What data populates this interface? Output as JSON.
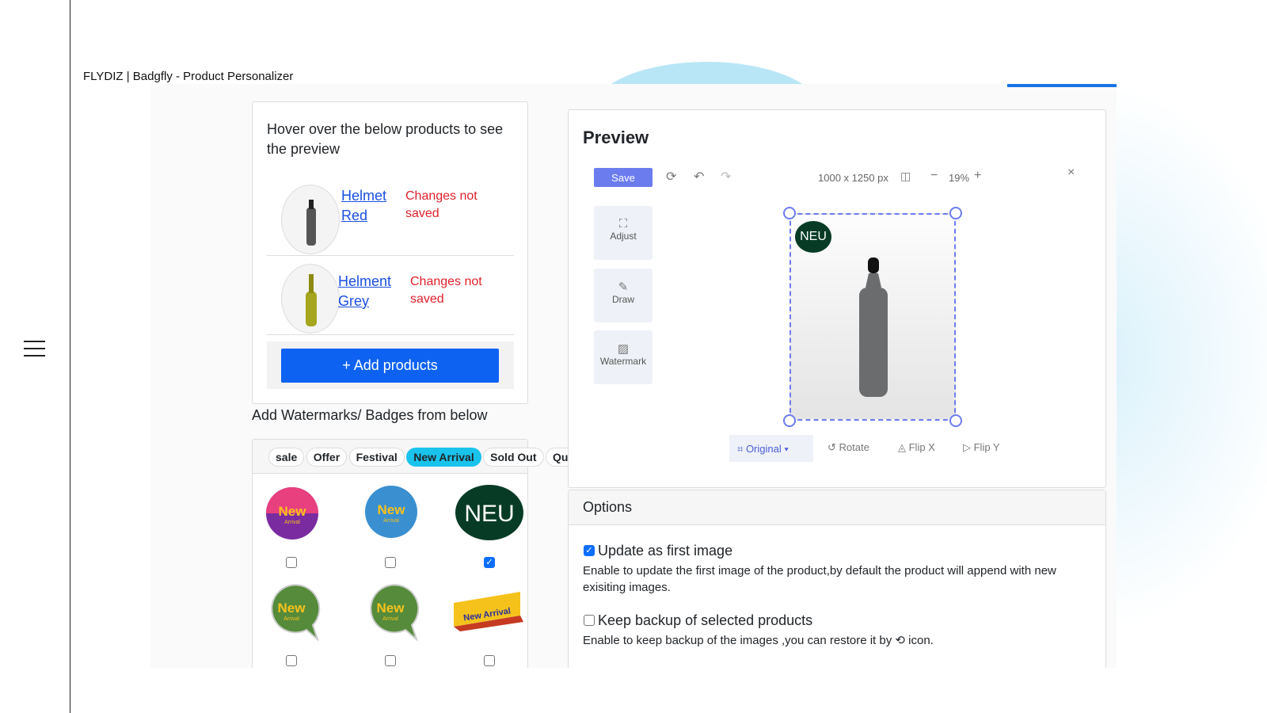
{
  "app_title": "FLYDIZ | Badgfly - Product Personalizer",
  "products": {
    "hint": "Hover over the below products to see the preview",
    "items": [
      {
        "name": "Helmet Red",
        "status": "Changes not saved"
      },
      {
        "name": "Helment Grey",
        "status": "Changes not saved"
      }
    ],
    "add_label": "+ Add products"
  },
  "badges": {
    "title": "Add Watermarks/ Badges from below",
    "tabs": [
      "sale",
      "Offer",
      "Festival",
      "New Arrival",
      "Sold Out",
      "Qu"
    ],
    "active_tab": "New Arrival",
    "items": [
      {
        "text": "New",
        "sub": "Arrival",
        "checked": false
      },
      {
        "text": "New",
        "sub": "Arrival",
        "checked": false
      },
      {
        "text": "NEU",
        "checked": true
      },
      {
        "text": "New",
        "sub": "Arrival",
        "checked": false
      },
      {
        "text": "New",
        "sub": "Arrival",
        "checked": false
      },
      {
        "text": "New Arrival",
        "checked": false
      }
    ]
  },
  "preview": {
    "title": "Preview",
    "save": "Save",
    "dimensions": "1000 x 1250 px",
    "zoom": "19%",
    "tools": [
      "Adjust",
      "Draw",
      "Watermark"
    ],
    "badge_text": "NEU",
    "ratio": "Original",
    "actions": [
      "Rotate",
      "Flip X",
      "Flip Y"
    ]
  },
  "options": {
    "title": "Options",
    "items": [
      {
        "label": "Update as first image",
        "checked": true,
        "desc": "Enable to update the first image of the product,by default the product will append with new exisiting images."
      },
      {
        "label": "Keep backup of selected products",
        "checked": false,
        "desc": "Enable to keep backup of the images ,you can restore it by ⟲ icon."
      }
    ]
  },
  "colors": {
    "primary": "#0d62f2",
    "accent": "#6b7cee",
    "active_tab": "#19c3ec",
    "error": "#e0202a"
  }
}
